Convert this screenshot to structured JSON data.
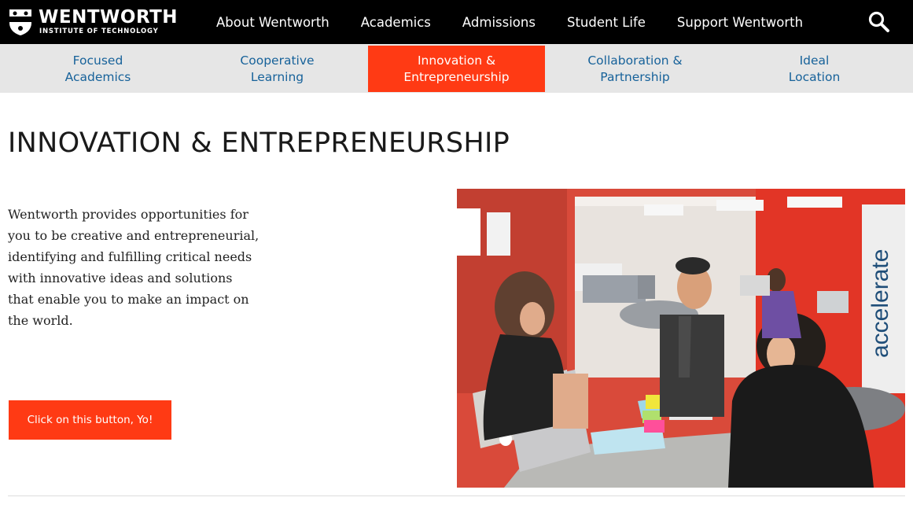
{
  "brand": {
    "name": "WENTWORTH",
    "tagline": "INSTITUTE OF TECHNOLOGY"
  },
  "main_nav": [
    {
      "label": "About Wentworth"
    },
    {
      "label": "Academics"
    },
    {
      "label": "Admissions"
    },
    {
      "label": "Student Life"
    },
    {
      "label": "Support Wentworth"
    }
  ],
  "search": {
    "icon": "search-icon"
  },
  "sub_nav": [
    {
      "label": "Focused\nAcademics",
      "active": false
    },
    {
      "label": "Cooperative\nLearning",
      "active": false
    },
    {
      "label": "Innovation &\nEntrepreneurship",
      "active": true
    },
    {
      "label": "Collaboration &\nPartnership",
      "active": false
    },
    {
      "label": "Ideal\nLocation",
      "active": false
    }
  ],
  "content": {
    "title": "INNOVATION & ENTREPRENEURSHIP",
    "body": "Wentworth provides opportunities for you to be creative and entrepreneurial, identifying and fulfilling critical needs with innovative ideas and solutions that enable you to make an impact on the world.",
    "cta_label": "Click on this button, Yo!",
    "wall_sign": "accelerate"
  },
  "colors": {
    "topbar": "#000000",
    "accent": "#ff3a14",
    "subnav_bg": "#e6e6e6",
    "subnav_text": "#17629a"
  }
}
